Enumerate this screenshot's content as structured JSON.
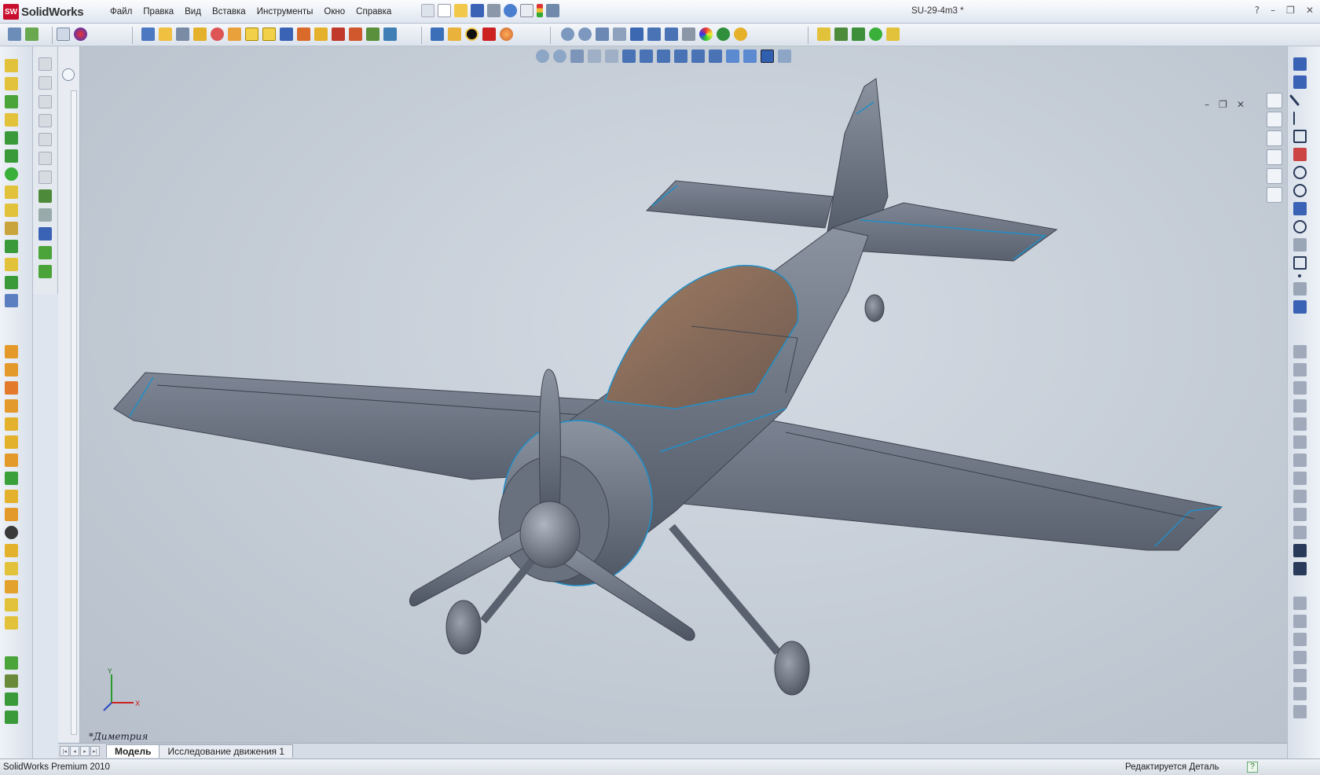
{
  "app": {
    "name": "SolidWorks",
    "logo_mark": "SW"
  },
  "menu": [
    "Файл",
    "Правка",
    "Вид",
    "Вставка",
    "Инструменты",
    "Окно",
    "Справка"
  ],
  "document_title": "SU-29-4m3 *",
  "window_controls": {
    "help": "?",
    "minimize": "–",
    "restore": "❐",
    "close": "✕"
  },
  "viewport_controls": {
    "minimize": "–",
    "restore": "❐",
    "close": "✕"
  },
  "view_orientation_label": "*Диметрия",
  "triad": {
    "x_label": "X",
    "y_label": "Y"
  },
  "tabs": [
    {
      "label": "Модель",
      "active": true
    },
    {
      "label": "Исследование движения 1",
      "active": false
    }
  ],
  "tab_nav": [
    "|◂",
    "◂",
    "▸",
    "▸|"
  ],
  "status": {
    "left": "SolidWorks Premium 2010",
    "right": "Редактируется Деталь",
    "help_icon": "?"
  },
  "colors": {
    "model_body": "#6e7684",
    "model_edge": "#1f8fc8",
    "canopy": "#8b6f5c",
    "viewport_bg": "#c6cdd6",
    "logo_red": "#c8102e"
  }
}
